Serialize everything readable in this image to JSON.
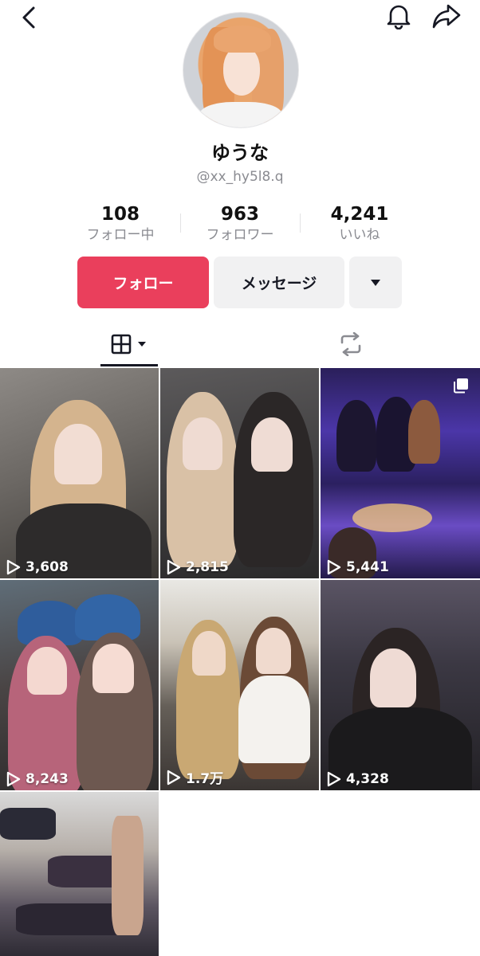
{
  "profile": {
    "display_name": "ゆうな",
    "username": "@xx_hy5l8.q"
  },
  "stats": {
    "following": {
      "value": "108",
      "label": "フォロー中"
    },
    "followers": {
      "value": "963",
      "label": "フォロワー"
    },
    "likes": {
      "value": "4,241",
      "label": "いいね"
    }
  },
  "actions": {
    "follow_label": "フォロー",
    "message_label": "メッセージ"
  },
  "colors": {
    "accent": "#ea3f5c",
    "secondary_button": "#f1f1f2",
    "muted_text": "#8a8b91"
  },
  "icons": {
    "top_left": "chevron-left-icon",
    "top_right": [
      "bell-icon",
      "share-icon"
    ],
    "tabs": [
      "grid-icon",
      "repost-icon"
    ]
  },
  "videos": [
    {
      "views": "3,608"
    },
    {
      "views": "2,815"
    },
    {
      "views": "5,441"
    },
    {
      "views": "8,243"
    },
    {
      "views": "1.7万"
    },
    {
      "views": "4,328"
    },
    {
      "views": ""
    }
  ]
}
